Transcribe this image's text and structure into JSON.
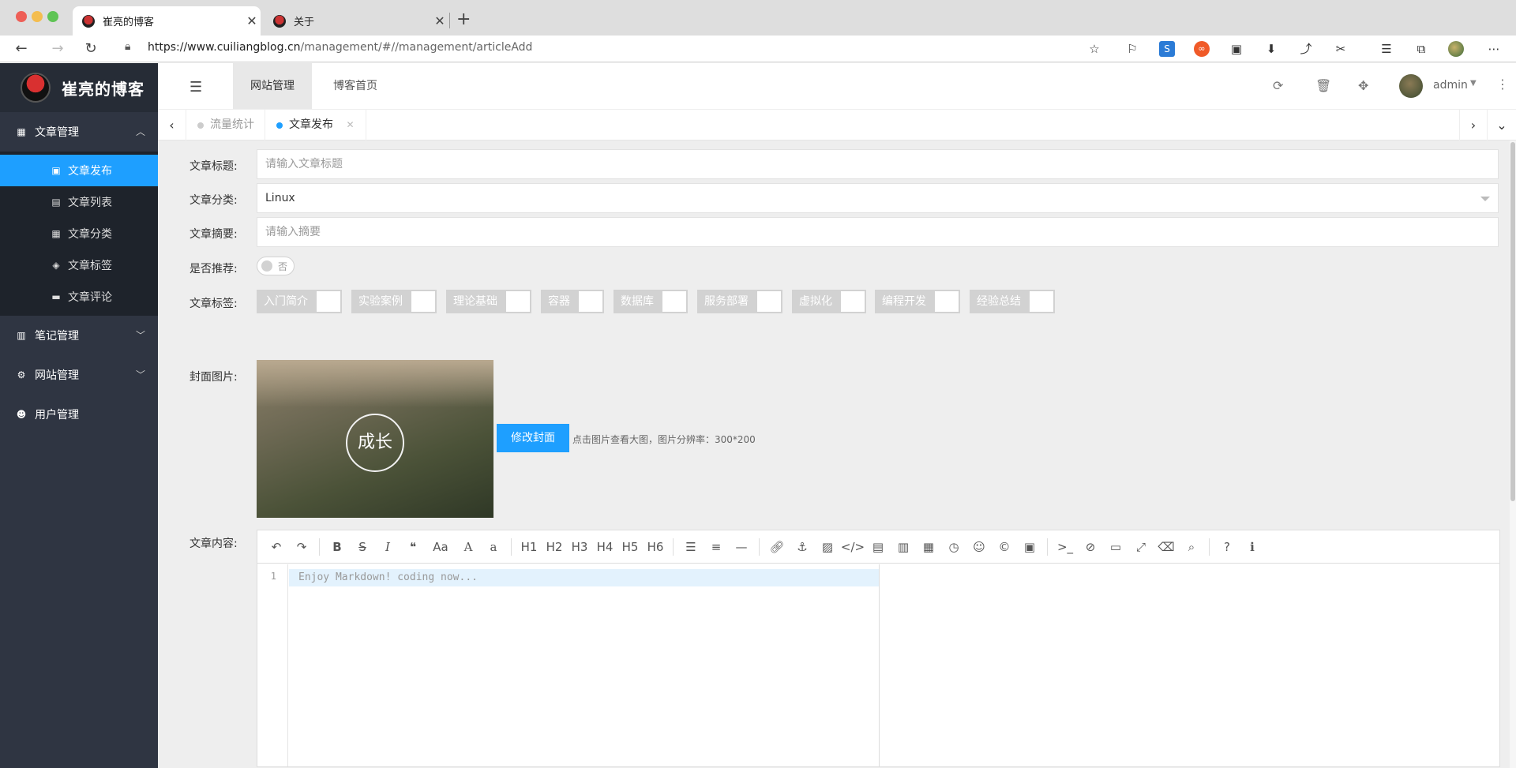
{
  "browser": {
    "tabs": [
      {
        "title": "崔亮的博客",
        "active": true
      },
      {
        "title": "关于",
        "active": false
      }
    ],
    "url_host": "https://www.cuiliangblog.cn",
    "url_path": "/management/#//management/articleAdd"
  },
  "sidebar": {
    "site_name": "崔亮的博客",
    "groups": [
      {
        "label": "文章管理",
        "icon": "calendar-icon",
        "expanded": true,
        "items": [
          {
            "label": "文章发布",
            "icon": "calendar-plus-icon",
            "active": true
          },
          {
            "label": "文章列表",
            "icon": "clipboard-icon"
          },
          {
            "label": "文章分类",
            "icon": "grid-icon"
          },
          {
            "label": "文章标签",
            "icon": "tags-icon"
          },
          {
            "label": "文章评论",
            "icon": "comment-icon"
          }
        ]
      },
      {
        "label": "笔记管理",
        "icon": "book-icon"
      },
      {
        "label": "网站管理",
        "icon": "cogs-icon"
      },
      {
        "label": "用户管理",
        "icon": "user-cog-icon"
      }
    ]
  },
  "header": {
    "tabs": [
      {
        "label": "网站管理",
        "active": true
      },
      {
        "label": "博客首页"
      }
    ],
    "username": "admin"
  },
  "page_tabs": [
    {
      "label": "流量统计"
    },
    {
      "label": "文章发布",
      "current": true
    }
  ],
  "form": {
    "title_label": "文章标题:",
    "title_placeholder": "请输入文章标题",
    "category_label": "文章分类:",
    "category_value": "Linux",
    "summary_label": "文章摘要:",
    "summary_placeholder": "请输入摘要",
    "recommend_label": "是否推荐:",
    "recommend_switch_text": "否",
    "tags_label": "文章标签:",
    "tags": [
      "入门简介",
      "实验案例",
      "理论基础",
      "容器",
      "数据库",
      "服务部署",
      "虚拟化",
      "编程开发",
      "经验总结"
    ],
    "cover_label": "封面图片:",
    "cover_image_text": "成长",
    "cover_button": "修改封面",
    "cover_tip": "点击图片查看大图，图片分辨率：300*200",
    "content_label": "文章内容:"
  },
  "editor": {
    "headings": [
      "H1",
      "H2",
      "H3",
      "H4",
      "H5",
      "H6"
    ],
    "line_number": "1",
    "placeholder": "Enjoy Markdown! coding now..."
  },
  "colors": {
    "accent": "#1e9fff",
    "sidebar_bg": "#2f3542",
    "sidebar_sub_bg": "#1e232b"
  }
}
